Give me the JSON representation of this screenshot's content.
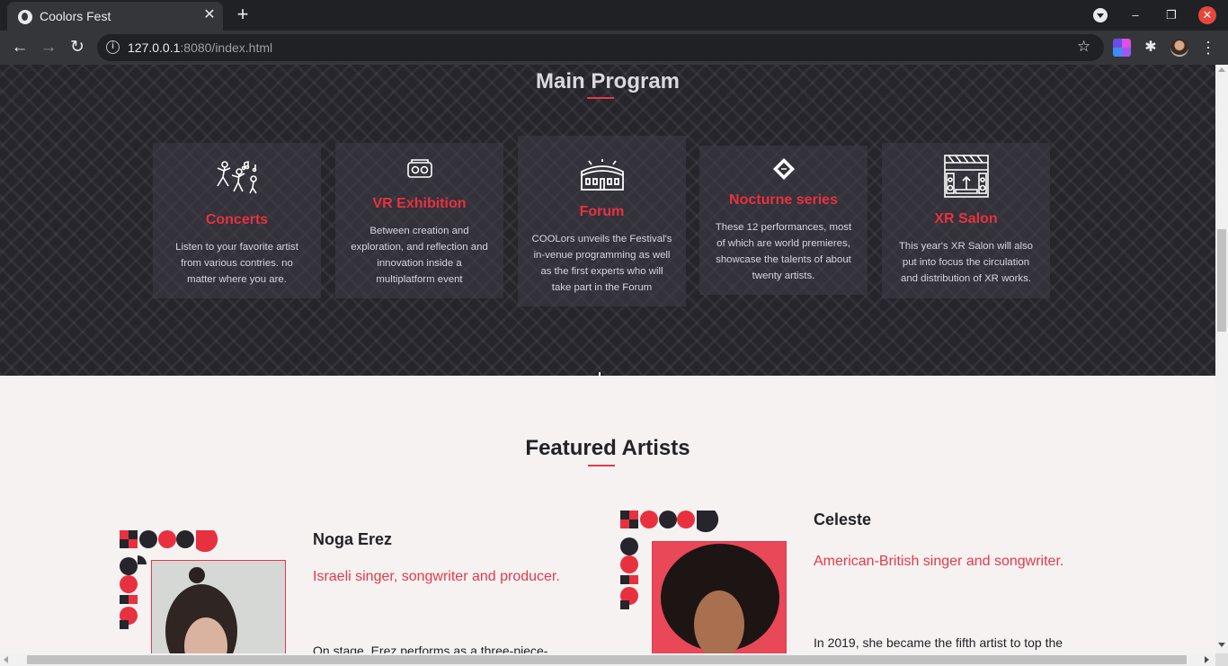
{
  "browser": {
    "tab_title": "Coolors Fest",
    "url_host": "127.0.0.1",
    "url_rest": ":8080/index.html"
  },
  "program": {
    "title": "Main Program",
    "cards": [
      {
        "icon": "dancers-music-icon",
        "title": "Concerts",
        "desc": "Listen to your favorite artist from various contries. no matter where you are."
      },
      {
        "icon": "vr-headset-icon",
        "title": "VR Exhibition",
        "desc": "Between creation and exploration, and reflection and innovation inside a multiplatform event"
      },
      {
        "icon": "arena-icon",
        "title": "Forum",
        "desc": "COOLors unveils the Festival's in-venue programming as well as the first experts who will take part in the Forum"
      },
      {
        "icon": "ticket-icon",
        "title": "Nocturne series",
        "desc": "These 12 performances, most of which are world premieres, showcase the talents of about twenty artists."
      },
      {
        "icon": "stage-icon",
        "title": "XR Salon",
        "desc": "This year's XR Salon will also put into focus the circulation and distribution of XR works."
      }
    ]
  },
  "artists": {
    "title": "Featured Artists",
    "items": [
      {
        "name": "Noga Erez",
        "role": "Israeli singer, songwriter and producer.",
        "bio": "On stage, Erez performs as a three-piece-"
      },
      {
        "name": "Celeste",
        "role": "American-British singer and songwriter.",
        "bio": "In 2019, she became the fifth artist to top the"
      }
    ]
  },
  "colors": {
    "accent": "#e53a49",
    "dark_bg": "#26252b",
    "light_bg": "#f6f2f2"
  }
}
